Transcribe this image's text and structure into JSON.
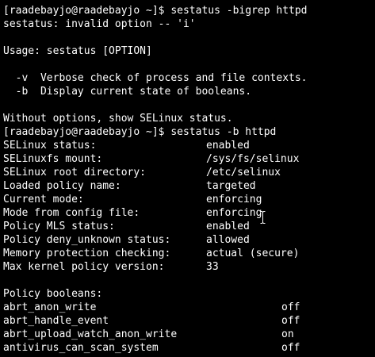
{
  "terminal": {
    "lines": [
      "[raadebayjo@raadebayjo ~]$ sestatus -bigrep httpd",
      "sestatus: invalid option -- 'i'",
      "",
      "Usage: sestatus [OPTION]",
      "",
      "  -v  Verbose check of process and file contexts.",
      "  -b  Display current state of booleans.",
      "",
      "Without options, show SELinux status.",
      "[raadebayjo@raadebayjo ~]$ sestatus -b httpd"
    ],
    "status": [
      {
        "key": "SELinux status:",
        "value": "enabled"
      },
      {
        "key": "SELinuxfs mount:",
        "value": "/sys/fs/selinux"
      },
      {
        "key": "SELinux root directory:",
        "value": "/etc/selinux"
      },
      {
        "key": "Loaded policy name:",
        "value": "targeted"
      },
      {
        "key": "Current mode:",
        "value": "enforcing"
      },
      {
        "key": "Mode from config file:",
        "value": "enforcing"
      },
      {
        "key": "Policy MLS status:",
        "value": "enabled"
      },
      {
        "key": "Policy deny_unknown status:",
        "value": "allowed"
      },
      {
        "key": "Memory protection checking:",
        "value": "actual (secure)"
      },
      {
        "key": "Max kernel policy version:",
        "value": "33"
      }
    ],
    "booleans_header": "Policy booleans:",
    "booleans": [
      {
        "key": "abrt_anon_write",
        "value": "off"
      },
      {
        "key": "abrt_handle_event",
        "value": "off"
      },
      {
        "key": "abrt_upload_watch_anon_write",
        "value": "on"
      },
      {
        "key": "antivirus_can_scan_system",
        "value": "off"
      }
    ]
  },
  "colors": {
    "background": "#000000",
    "foreground": "#ffffff"
  }
}
